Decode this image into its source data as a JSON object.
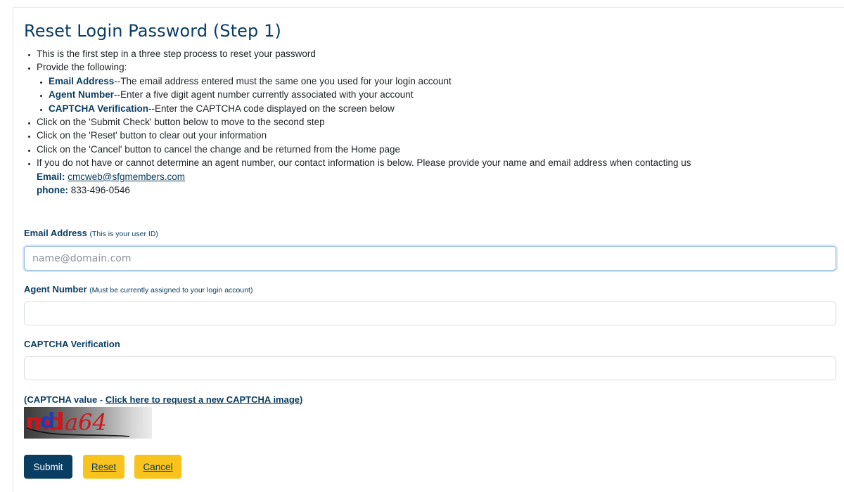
{
  "page": {
    "title": "Reset Login Password (Step 1)"
  },
  "instructions": {
    "item1": "This is the first step in a three step process to reset your password",
    "item2": "Provide the following:",
    "sub": [
      {
        "term": "Email Address",
        "text": "--The email address entered must the same one you used for your login account"
      },
      {
        "term": "Agent Number",
        "text": "--Enter a five digit agent number currently associated with your account"
      },
      {
        "term": "CAPTCHA Verification",
        "text": "--Enter the CAPTCHA code displayed on the screen below"
      }
    ],
    "item3": "Click on the 'Submit Check' button below to move to the second step",
    "item4": "Click on the 'Reset' button to clear out your information",
    "item5": "Click on the 'Cancel' button to cancel the change and be returned from the Home page",
    "item6": "If you do not have or cannot determine an agent number, our contact information is below.  Please provide your name and email address when contacting us",
    "contact": {
      "email_label": "Email:",
      "email_value": "cmcweb@sfgmembers.com",
      "phone_label": "phone:",
      "phone_value": "833-496-0546"
    }
  },
  "form": {
    "email": {
      "label": "Email Address",
      "hint": "(This is your user ID)",
      "placeholder": "name@domain.com",
      "value": ""
    },
    "agent": {
      "label": "Agent Number",
      "hint": "(Must be currently assigned to your login account)",
      "value": ""
    },
    "captcha": {
      "label": "CAPTCHA Verification",
      "value": ""
    },
    "captcha_prefix": "(CAPTCHA value - ",
    "captcha_link": "Click here to request a new CAPTCHA image",
    "captcha_suffix": ")",
    "captcha_image_text": "mda64"
  },
  "buttons": {
    "submit": "Submit",
    "reset": "Reset",
    "cancel": "Cancel"
  },
  "colors": {
    "primary": "#0a3d62",
    "accent": "#f7c31c"
  }
}
